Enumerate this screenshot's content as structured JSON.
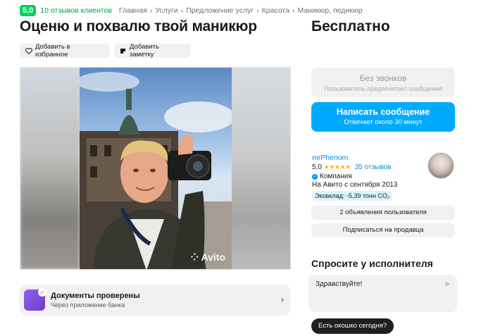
{
  "header": {
    "rating": "5,0",
    "reviews": "10 отзывов клиентов",
    "breadcrumbs": [
      "Главная",
      "Услуги",
      "Предложение услуг",
      "Красота",
      "Маникюр, педикюр"
    ]
  },
  "listing": {
    "title": "Оценю и похвалю твой маникюр",
    "price": "Бесплатно",
    "fav_label": "Добавить в избранное",
    "note_label": "Добавить заметку",
    "watermark": "Avito"
  },
  "docs": {
    "title": "Документы проверены",
    "subtitle": "Через приложение банка"
  },
  "contact": {
    "no_calls": "Без звонков",
    "no_calls_sub": "Пользователь предпочитает сообщения",
    "write": "Написать сообщение",
    "write_sub": "Отвечает около 30 минут"
  },
  "seller": {
    "name": "mrPhenom",
    "rating": "5,0",
    "stars": "★★★★★",
    "reviews": "35 отзывов",
    "type": "Компания",
    "since": "На Авито с сентября 2013",
    "eco": "Эковклад: -5,39 тонн CO₂",
    "ads_btn": "2 объявления пользователя",
    "subscribe_btn": "Подписаться на продавца"
  },
  "ask": {
    "title": "Спросите у исполнителя",
    "message": "Здравствуйте!",
    "quick_reply": "Есть окошко сегодня?"
  },
  "colors": {
    "green": "#02d15c",
    "blue": "#00aaff",
    "link": "#0a8ad6"
  }
}
